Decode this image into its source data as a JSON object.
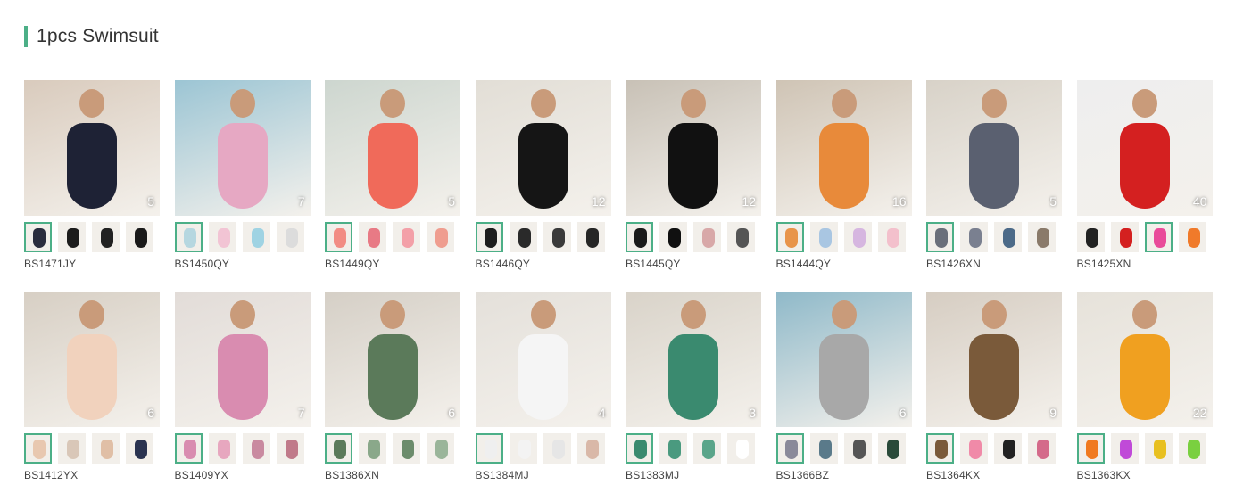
{
  "section": {
    "title": "1pcs Swimsuit"
  },
  "products": [
    {
      "sku": "BS1471JY",
      "count": "5",
      "bg": "#d9cbbd",
      "suit": "#1e2235",
      "thumbs": [
        "#2a2d3e",
        "#1c1c1c",
        "#222222",
        "#1a1a1a"
      ],
      "selected": 0
    },
    {
      "sku": "BS1450QY",
      "count": "7",
      "bg": "#9cc5d4",
      "suit": "#e6a8c3",
      "thumbs": [
        "#b6d7e0",
        "#f2c4d4",
        "#9fd3e3",
        "#dcdcdc"
      ],
      "selected": 0
    },
    {
      "sku": "BS1449QY",
      "count": "5",
      "bg": "#cdd6cf",
      "suit": "#f06a5a",
      "thumbs": [
        "#f28c84",
        "#e87a85",
        "#f3a0a8",
        "#ef9d8f"
      ],
      "selected": 0
    },
    {
      "sku": "BS1446QY",
      "count": "12",
      "bg": "#e2ded6",
      "suit": "#151515",
      "thumbs": [
        "#1d1d1d",
        "#2a2a2a",
        "#3a3a3a",
        "#262626"
      ],
      "selected": 0
    },
    {
      "sku": "BS1445QY",
      "count": "12",
      "bg": "#c8c1b6",
      "suit": "#111111",
      "thumbs": [
        "#1a1a1a",
        "#101010",
        "#d8a8a8",
        "#555555"
      ],
      "selected": 0
    },
    {
      "sku": "BS1444QY",
      "count": "16",
      "bg": "#cfc4b5",
      "suit": "#e88a3a",
      "thumbs": [
        "#e8944a",
        "#a9c6e2",
        "#d6b6e0",
        "#f3c0cc"
      ],
      "selected": 0
    },
    {
      "sku": "BS1426XN",
      "count": "5",
      "bg": "#d8d2c8",
      "suit": "#5a6070",
      "thumbs": [
        "#6a6f7a",
        "#7a8090",
        "#4c6a88",
        "#8a7a6a"
      ],
      "selected": 0
    },
    {
      "sku": "BS1425XN",
      "count": "40",
      "bg": "#eeeeee",
      "suit": "#d42020",
      "thumbs": [
        "#222222",
        "#d42020",
        "#e94b9a",
        "#f07a2a"
      ],
      "selected": 2
    },
    {
      "sku": "BS1412YX",
      "count": "6",
      "bg": "#d7cfc4",
      "suit": "#f1d2bd",
      "thumbs": [
        "#e8c8b0",
        "#d9c7b8",
        "#e0bfa6",
        "#2a3350"
      ],
      "selected": 0
    },
    {
      "sku": "BS1409YX",
      "count": "7",
      "bg": "#e2dcd8",
      "suit": "#d98cb0",
      "thumbs": [
        "#d98cb0",
        "#e7a7bf",
        "#c98aa0",
        "#c07a8a"
      ],
      "selected": 0
    },
    {
      "sku": "BS1386XN",
      "count": "6",
      "bg": "#d5cfc6",
      "suit": "#5b7a5a",
      "thumbs": [
        "#5b7a5a",
        "#8aa88a",
        "#6c8c6c",
        "#9ab59a"
      ],
      "selected": 0
    },
    {
      "sku": "BS1384MJ",
      "count": "4",
      "bg": "#e4e0da",
      "suit": "#f5f5f5",
      "thumbs": [
        "#efefef",
        "#f3f3f3",
        "#e6e6e6",
        "#d9b8a8"
      ],
      "selected": 0
    },
    {
      "sku": "BS1383MJ",
      "count": "3",
      "bg": "#d9d3c9",
      "suit": "#3a8a6f",
      "thumbs": [
        "#3a8a6f",
        "#4a9a7f",
        "#5aa58a",
        "#ffffff"
      ],
      "selected": 0
    },
    {
      "sku": "BS1366BZ",
      "count": "6",
      "bg": "#8fb9c9",
      "suit": "#a8a8a8",
      "thumbs": [
        "#8a8a9a",
        "#5a7a8a",
        "#555555",
        "#2a4a3a"
      ],
      "selected": 0
    },
    {
      "sku": "BS1364KX",
      "count": "9",
      "bg": "#d6cdc2",
      "suit": "#7a5a3a",
      "thumbs": [
        "#7a5a3a",
        "#f08aa8",
        "#222222",
        "#d46a8a"
      ],
      "selected": 0
    },
    {
      "sku": "BS1363KX",
      "count": "22",
      "bg": "#e6e2da",
      "suit": "#f0a020",
      "thumbs": [
        "#f07a20",
        "#c04ad8",
        "#e8c020",
        "#7ad040"
      ],
      "selected": 0
    }
  ]
}
